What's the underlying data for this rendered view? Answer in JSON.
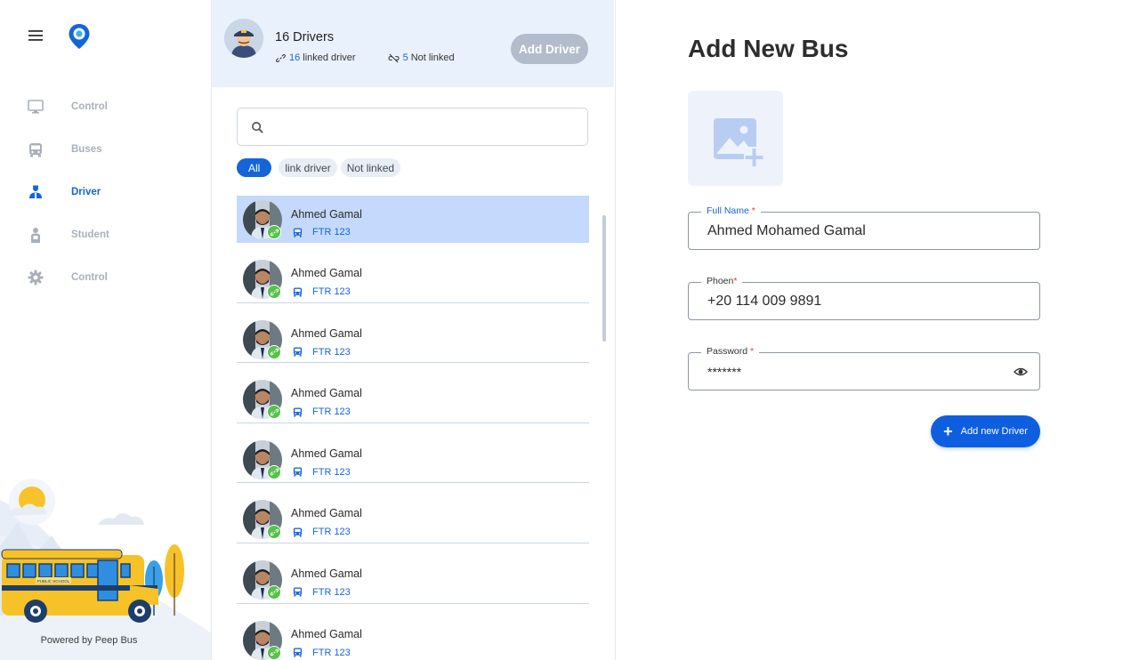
{
  "sidebar": {
    "items": [
      {
        "label": "Control",
        "icon": "monitor-icon",
        "active": false
      },
      {
        "label": "Buses",
        "icon": "bus-icon",
        "active": false
      },
      {
        "label": "Driver",
        "icon": "driver-icon",
        "active": true
      },
      {
        "label": "Student",
        "icon": "student-icon",
        "active": false
      },
      {
        "label": "Control",
        "icon": "gear-icon",
        "active": false
      }
    ],
    "powered_by": "Powered by Peep Bus",
    "bus_sign": "PUBLIC SCHOOL"
  },
  "drivers_panel": {
    "title": "16 Drivers",
    "linked_count": "16",
    "linked_label": "linked driver",
    "not_linked_count": "5",
    "not_linked_label": "Not linked",
    "add_driver_label": "Add Driver",
    "search_placeholder": "",
    "filters": [
      "All",
      "link driver",
      "Not linked"
    ],
    "drivers": [
      {
        "name": "Ahmed Gamal",
        "bus": "FTR 123"
      },
      {
        "name": "Ahmed Gamal",
        "bus": "FTR 123"
      },
      {
        "name": "Ahmed Gamal",
        "bus": "FTR 123"
      },
      {
        "name": "Ahmed Gamal",
        "bus": "FTR 123"
      },
      {
        "name": "Ahmed Gamal",
        "bus": "FTR 123"
      },
      {
        "name": "Ahmed Gamal",
        "bus": "FTR 123"
      },
      {
        "name": "Ahmed Gamal",
        "bus": "FTR 123"
      },
      {
        "name": "Ahmed Gamal",
        "bus": "FTR 123"
      }
    ]
  },
  "form": {
    "title": "Add New Bus",
    "full_name_label": "Full Name",
    "full_name_value": "Ahmed Mohamed Gamal",
    "phone_label": "Phoen",
    "phone_value": "+20 114 009 9891",
    "password_label": "Password",
    "password_value": "*******",
    "required_mark": "*",
    "submit_label": "Add new Driver"
  },
  "colors": {
    "primary": "#1565d8",
    "header_bg": "#e9f1fd",
    "selected_row": "#c4d9fb",
    "link_badge": "#56c24a",
    "disabled_button": "#b2bccb"
  }
}
